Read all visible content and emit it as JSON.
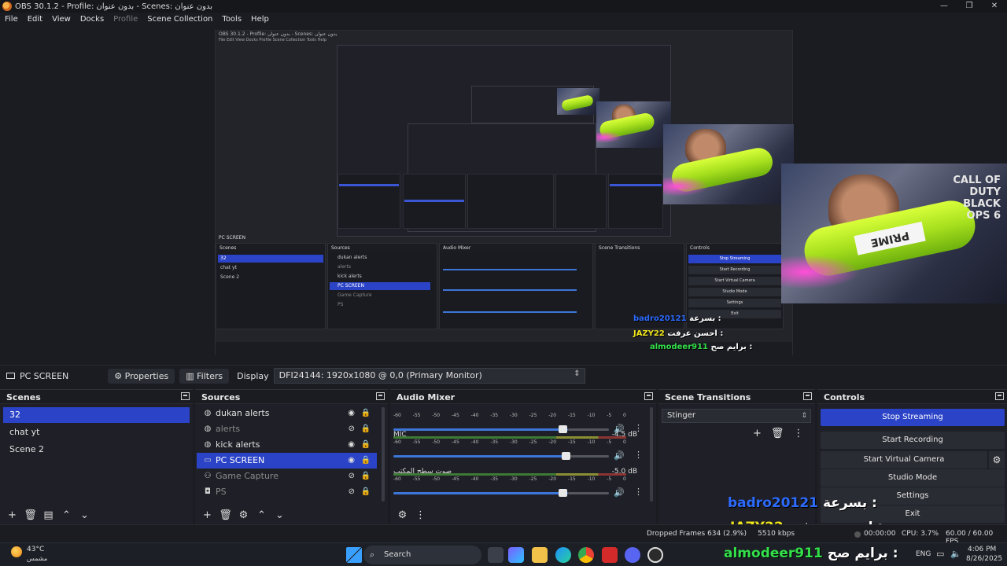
{
  "window": {
    "title": "OBS 30.1.2 - Profile: بدون عنوان - Scenes: بدون عنوان",
    "controls": [
      "—",
      "❐",
      "✕"
    ]
  },
  "menu": [
    "File",
    "Edit",
    "View",
    "Docks",
    "Profile",
    "Scene Collection",
    "Tools",
    "Help"
  ],
  "nested_preview": {
    "title": "OBS 30.1.2 - Profile: بدون عنوان - Scenes: بدون عنوان",
    "menu": "File   Edit   View   Docks   Profile   Scene Collection   Tools   Help",
    "source_bar": "PC SCREEN",
    "scenes": [
      "32",
      "chat yt",
      "Scene 2"
    ],
    "sources": [
      "dukan alerts",
      "alerts",
      "kick alerts",
      "PC SCREEN",
      "Game Capture",
      "PS"
    ],
    "controls": [
      "Stop Streaming",
      "Start Recording",
      "Start Virtual Camera",
      "Studio Mode",
      "Settings",
      "Exit"
    ]
  },
  "camera": {
    "bottle_label": "PRIME",
    "game_logo": "CALL OF DUTY BLACK OPS 6"
  },
  "chat": {
    "line1": {
      "label": "بسرعة :",
      "name": "badro20121"
    },
    "line2": {
      "label": "احسن عرفت :",
      "name": "JAZY22"
    },
    "line3": {
      "label": "برايم صح :",
      "name": "almodeer911"
    }
  },
  "source_toolbar": {
    "source_name": "PC SCREEN",
    "properties_label": "Properties",
    "filters_label": "Filters",
    "display_label": "Display",
    "display_value": "DFI24144: 1920x1080 @ 0,0 (Primary Monitor)"
  },
  "scenes": {
    "title": "Scenes",
    "items": [
      "32",
      "chat yt",
      "Scene 2"
    ],
    "selected": 0
  },
  "sources": {
    "title": "Sources",
    "items": [
      {
        "label": "dukan alerts",
        "icon": "globe-icon",
        "visible": true
      },
      {
        "label": "alerts",
        "icon": "globe-icon",
        "visible": false
      },
      {
        "label": "kick alerts",
        "icon": "globe-icon",
        "visible": true
      },
      {
        "label": "PC SCREEN",
        "icon": "monitor-icon",
        "visible": true
      },
      {
        "label": "Game Capture",
        "icon": "gamepad-icon",
        "visible": false
      },
      {
        "label": "PS",
        "icon": "camera-icon",
        "visible": false
      }
    ],
    "selected": 3
  },
  "audio_mixer": {
    "title": "Audio Mixer",
    "ticks": [
      "-60",
      "-55",
      "-50",
      "-45",
      "-40",
      "-35",
      "-30",
      "-25",
      "-20",
      "-15",
      "-10",
      "-5",
      "0"
    ],
    "channels": [
      {
        "name": "",
        "db": "",
        "volume_fraction": 0.75
      },
      {
        "name": "MIC",
        "db": "-4.5 dB",
        "volume_fraction": 0.76
      },
      {
        "name": "صوت سطح المكتب",
        "db": "-5.0 dB",
        "volume_fraction": 0.75
      }
    ]
  },
  "transitions": {
    "title": "Scene Transitions",
    "selected": "Stinger"
  },
  "controls": {
    "title": "Controls",
    "buttons": [
      "Stop Streaming",
      "Start Recording",
      "Start Virtual Camera",
      "Studio Mode",
      "Settings",
      "Exit"
    ]
  },
  "status": {
    "dropped": "Dropped Frames 634 (2.9%)",
    "kbps": "5510 kbps",
    "rec_time": "00:00:00",
    "cpu": "CPU: 3.7%",
    "fps": "60.00 / 60.00 FPS"
  },
  "taskbar": {
    "weather_temp": "43°C",
    "weather_desc": "مشمس",
    "search_placeholder": "Search",
    "lang": "ENG",
    "time": "4:06 PM",
    "date": "8/26/2025"
  },
  "colors": {
    "accent": "#2b43c7",
    "chat_name": "#2d6bff",
    "chat_name_yellow": "#f0e61e",
    "chat_name_green": "#33e04a"
  }
}
